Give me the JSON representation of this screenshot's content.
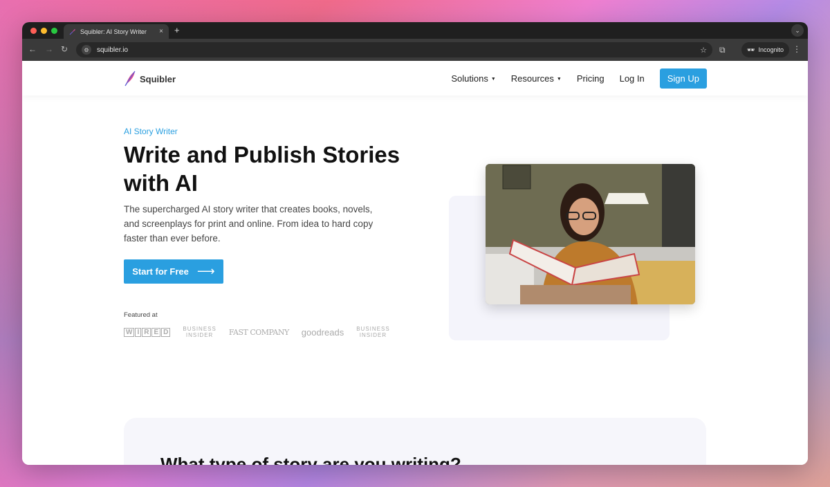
{
  "browser": {
    "tab_title": "Squibler: AI Story Writer",
    "tab_close": "×",
    "new_tab": "+",
    "url": "squibler.io",
    "incognito_label": "Incognito"
  },
  "nav": {
    "logo_text": "Squibler",
    "solutions": "Solutions",
    "resources": "Resources",
    "pricing": "Pricing",
    "login": "Log In",
    "signup": "Sign Up"
  },
  "hero": {
    "eyebrow": "AI Story Writer",
    "headline": "Write and Publish Stories with AI",
    "subhead": "The supercharged AI story writer that creates books, novels, and screenplays for print and online. From idea to hard copy faster than ever before.",
    "cta": "Start for Free",
    "featured_label": "Featured at",
    "press": {
      "wired": [
        "W",
        "I",
        "R",
        "E",
        "D"
      ],
      "business_insider_1": "BUSINESS\nINSIDER",
      "fast_company": "FAST COMPANY",
      "goodreads": "goodreads",
      "business_insider_2": "BUSINESS\nINSIDER"
    }
  },
  "section2": {
    "title": "What type of story are you writing?"
  },
  "colors": {
    "accent": "#2a9fe0",
    "headline": "#111111"
  }
}
